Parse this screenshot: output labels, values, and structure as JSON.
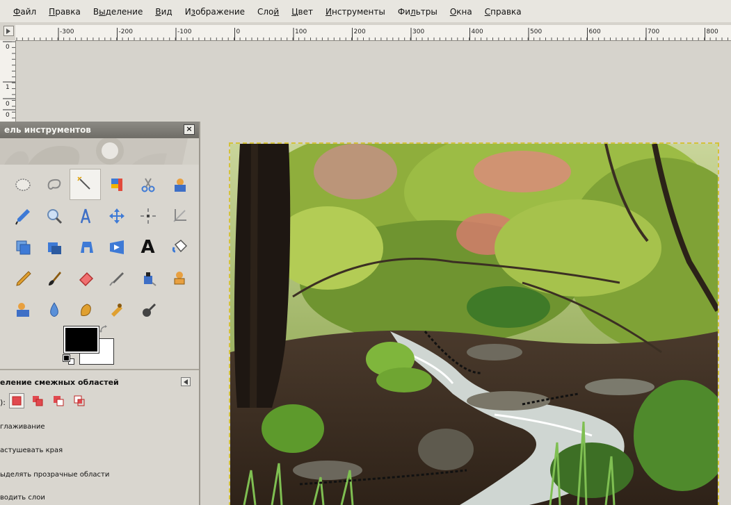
{
  "menu": [
    {
      "pre": "",
      "u": "Ф",
      "post": "айл"
    },
    {
      "pre": "",
      "u": "П",
      "post": "равка"
    },
    {
      "pre": "В",
      "u": "ы",
      "post": "деление"
    },
    {
      "pre": "",
      "u": "В",
      "post": "ид"
    },
    {
      "pre": "И",
      "u": "з",
      "post": "ображение"
    },
    {
      "pre": "Сло",
      "u": "й",
      "post": ""
    },
    {
      "pre": "",
      "u": "Ц",
      "post": "вет"
    },
    {
      "pre": "",
      "u": "И",
      "post": "нструменты"
    },
    {
      "pre": "Фи",
      "u": "л",
      "post": "ьтры"
    },
    {
      "pre": "",
      "u": "О",
      "post": "кна"
    },
    {
      "pre": "",
      "u": "С",
      "post": "правка"
    }
  ],
  "ruler": {
    "h_labels": [
      "-300",
      "-200",
      "-100",
      "0",
      "100",
      "200",
      "300",
      "400",
      "500",
      "600",
      "700",
      "800"
    ],
    "v_labels": [
      "0",
      "1",
      "0",
      "0"
    ]
  },
  "toolbox": {
    "title": "ель инструментов",
    "close": "×",
    "tools": [
      "ellipse-select-icon",
      "free-select-icon",
      "fuzzy-select-icon",
      "color-select-icon",
      "scissors-icon",
      "foreground-select-icon",
      "color-picker-icon",
      "zoom-icon",
      "measure-icon",
      "move-icon",
      "align-icon",
      "crop-icon",
      "rotate-icon",
      "scale-icon",
      "shear-icon",
      "perspective-icon",
      "text-icon",
      "bucket-fill-icon",
      "pencil-icon",
      "paintbrush-icon",
      "eraser-icon",
      "airbrush-icon",
      "ink-icon",
      "clone-icon",
      "heal-icon",
      "blur-icon",
      "smudge-icon",
      "dodge-burn-icon",
      "dodge-icon"
    ],
    "active_tool": "fuzzy-select-icon",
    "text_tool_glyph": "A",
    "colors": {
      "foreground": "#000000",
      "background": "#ffffff"
    }
  },
  "options": {
    "title": "еление смежных областей",
    "mode_prefix": "):",
    "lines": [
      "глаживание",
      "астушевать края",
      "ыделять прозрачные области",
      "водить слои"
    ]
  },
  "accent": {
    "selection": "#d4c23a",
    "title_bar": "#7c7a74"
  }
}
